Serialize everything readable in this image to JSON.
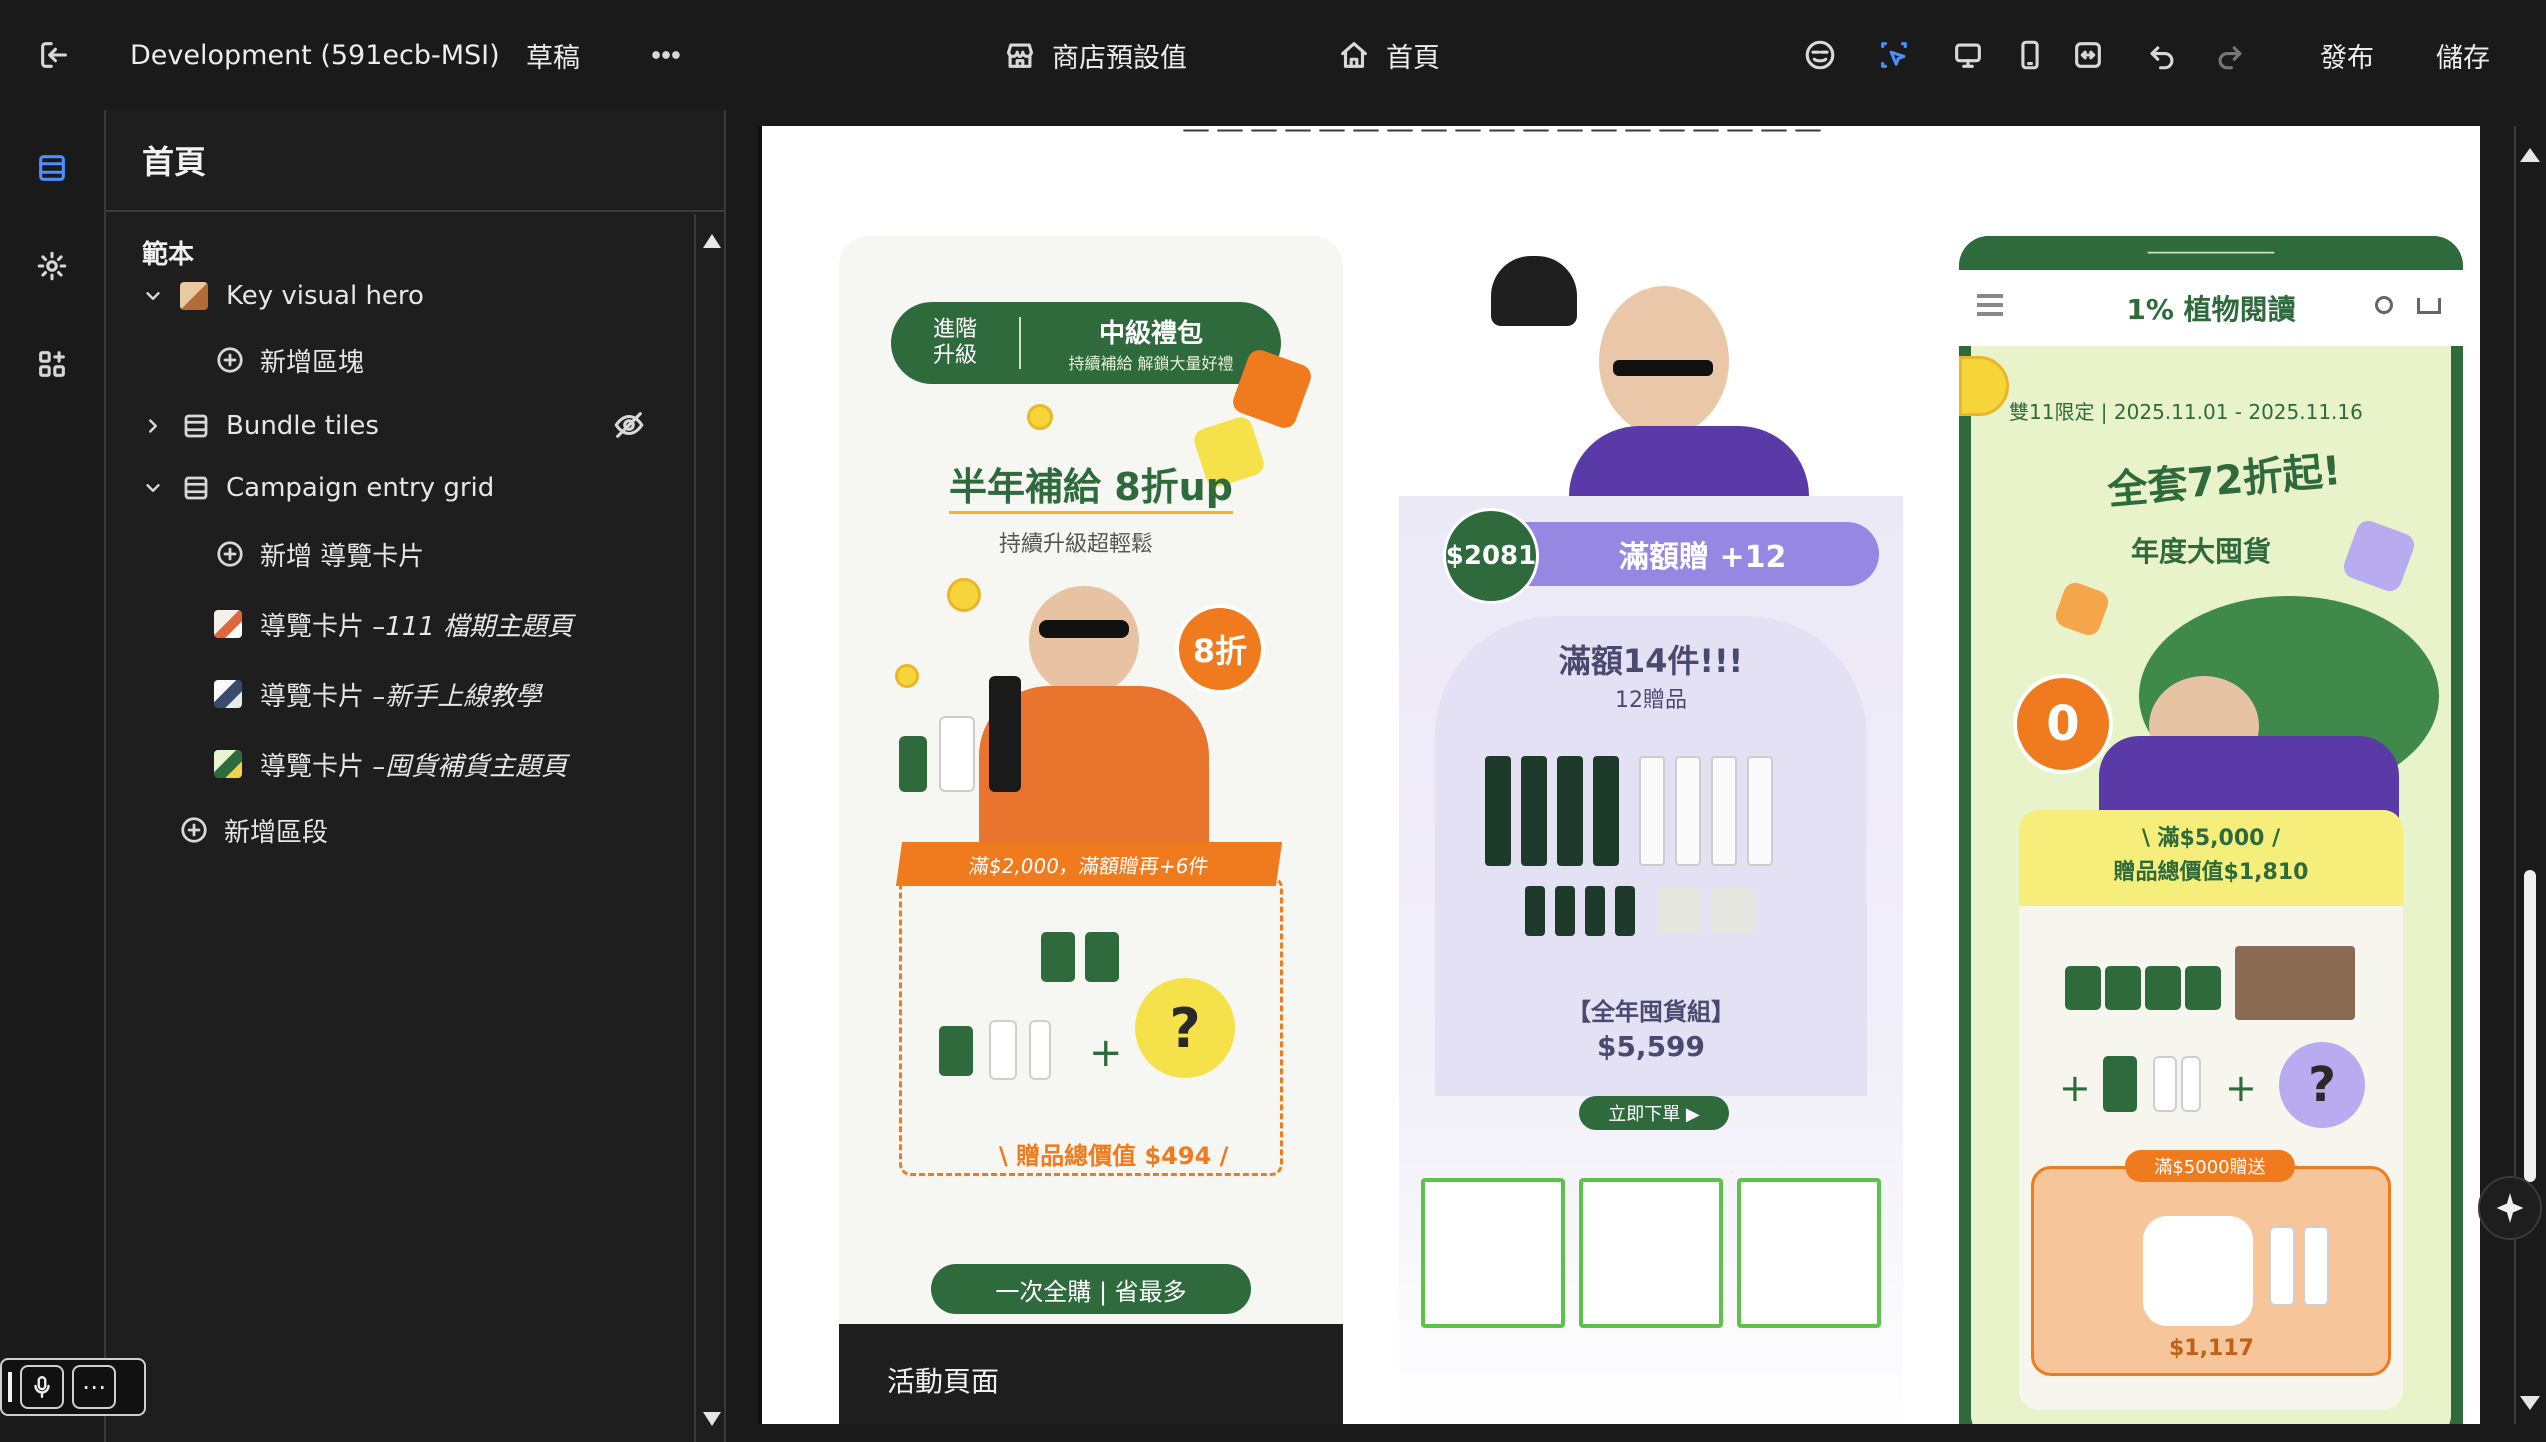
{
  "topbar": {
    "store_name": "Development (591ecb-MSI)",
    "status": "草稿",
    "theme_label": "商店預設值",
    "page_label": "首頁",
    "publish": "發布",
    "save": "儲存"
  },
  "sidebar": {
    "title": "首頁",
    "section_label": "範本",
    "items": [
      {
        "label": "Key visual hero"
      },
      {
        "label": "新增區塊"
      },
      {
        "label": "Bundle tiles"
      },
      {
        "label": "Campaign entry grid"
      },
      {
        "label": "新增 導覽卡片"
      },
      {
        "prefix": "導覽卡片 – ",
        "label": "111 檔期主題頁"
      },
      {
        "prefix": "導覽卡片 – ",
        "label": "新手上線教學"
      },
      {
        "prefix": "導覽卡片 – ",
        "label": "囤貨補貨主題頁"
      },
      {
        "label": "新增區段"
      }
    ]
  },
  "preview": {
    "card1": {
      "pill_left": "進階\n升級",
      "pill_title": "中級禮包",
      "pill_sub": "持續補給 解鎖大量好禮",
      "headline": "半年補給 8折up",
      "sub": "持續升級超輕鬆",
      "badge": "8折",
      "ribbon": "滿$2,000，滿額贈再+6件",
      "qmark": "?",
      "total": "\\ 贈品總價值 $494 /",
      "cta": "一次全購 | 省最多",
      "label": "活動頁面"
    },
    "card2": {
      "coin": "$2081",
      "banner": "滿額贈 +12",
      "heading": "滿額14件!!!",
      "sub": "12贈品",
      "bundle": "【全年囤貨組】",
      "price": "$5,599",
      "cta": "立即下單 ▶"
    },
    "card3": {
      "brand": "1% 植物閱讀",
      "date": "雙11限定 | 2025.11.01 - 2025.11.16",
      "big": "全套72折起!",
      "sub": "年度大囤貨",
      "zero": "0",
      "yellow_line1": "\\ 滿$5,000 /",
      "yellow_line2": "贈品總價值$1,810",
      "orange_label": "滿$5000贈送",
      "orange_price": "$1,117"
    }
  },
  "mic_toolbar": {
    "more": "⋯"
  }
}
